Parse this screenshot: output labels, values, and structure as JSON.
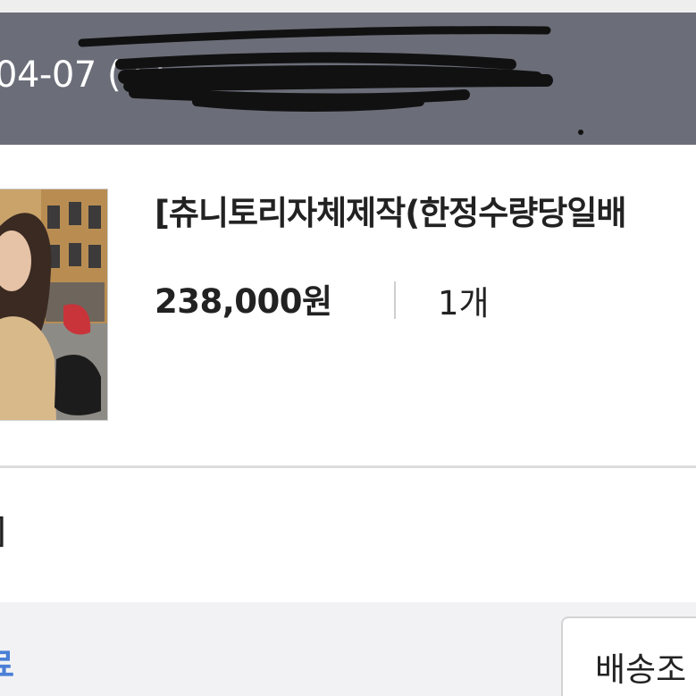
{
  "order": {
    "date_visible": "04-07 (22"
  },
  "product": {
    "name": "[츄니토리자체제작(한정수량당일배",
    "price": "238,000원",
    "quantity": "1개",
    "image_icon": "product-photo"
  },
  "option": {
    "text": "]"
  },
  "footer": {
    "link_label": "료",
    "track_button_label": "배송조"
  },
  "colors": {
    "header_bg": "#6b6e79",
    "link_blue": "#4a7fd6",
    "text_dark": "#222222"
  }
}
